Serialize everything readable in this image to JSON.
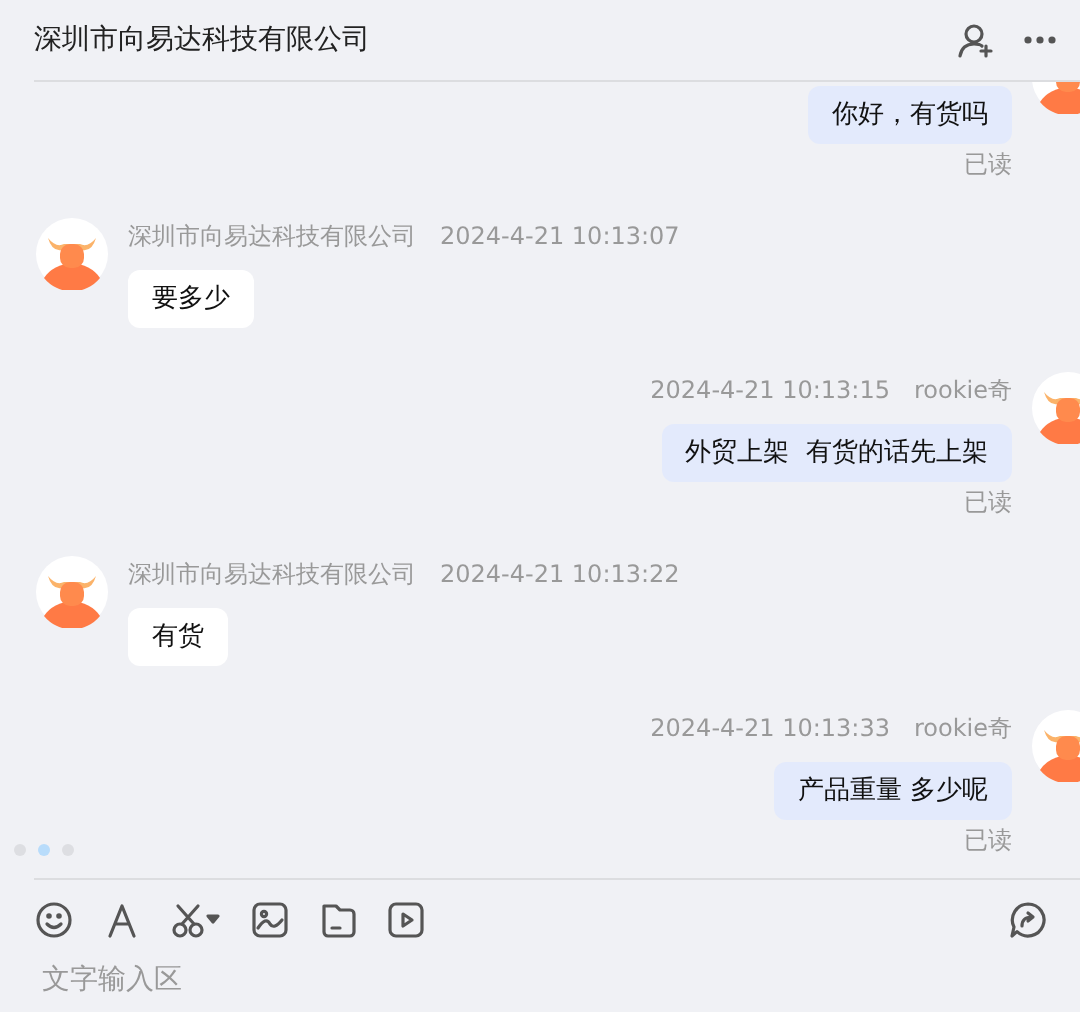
{
  "header": {
    "title": "深圳市向易达科技有限公司"
  },
  "messages": [
    {
      "kind": "outgoing",
      "text": "你好，有货吗",
      "status": "已读"
    },
    {
      "kind": "incoming",
      "sender": "深圳市向易达科技有限公司",
      "time": "2024-4-21 10:13:07",
      "text": "要多少"
    },
    {
      "kind": "outgoing",
      "sender": "rookie奇",
      "time": "2024-4-21 10:13:15",
      "text": "外贸上架  有货的话先上架",
      "status": "已读"
    },
    {
      "kind": "incoming",
      "sender": "深圳市向易达科技有限公司",
      "time": "2024-4-21 10:13:22",
      "text": "有货"
    },
    {
      "kind": "outgoing",
      "sender": "rookie奇",
      "time": "2024-4-21 10:13:33",
      "text": "产品重量 多少呢",
      "status": "已读"
    }
  ],
  "composer": {
    "placeholder": "文字输入区"
  }
}
